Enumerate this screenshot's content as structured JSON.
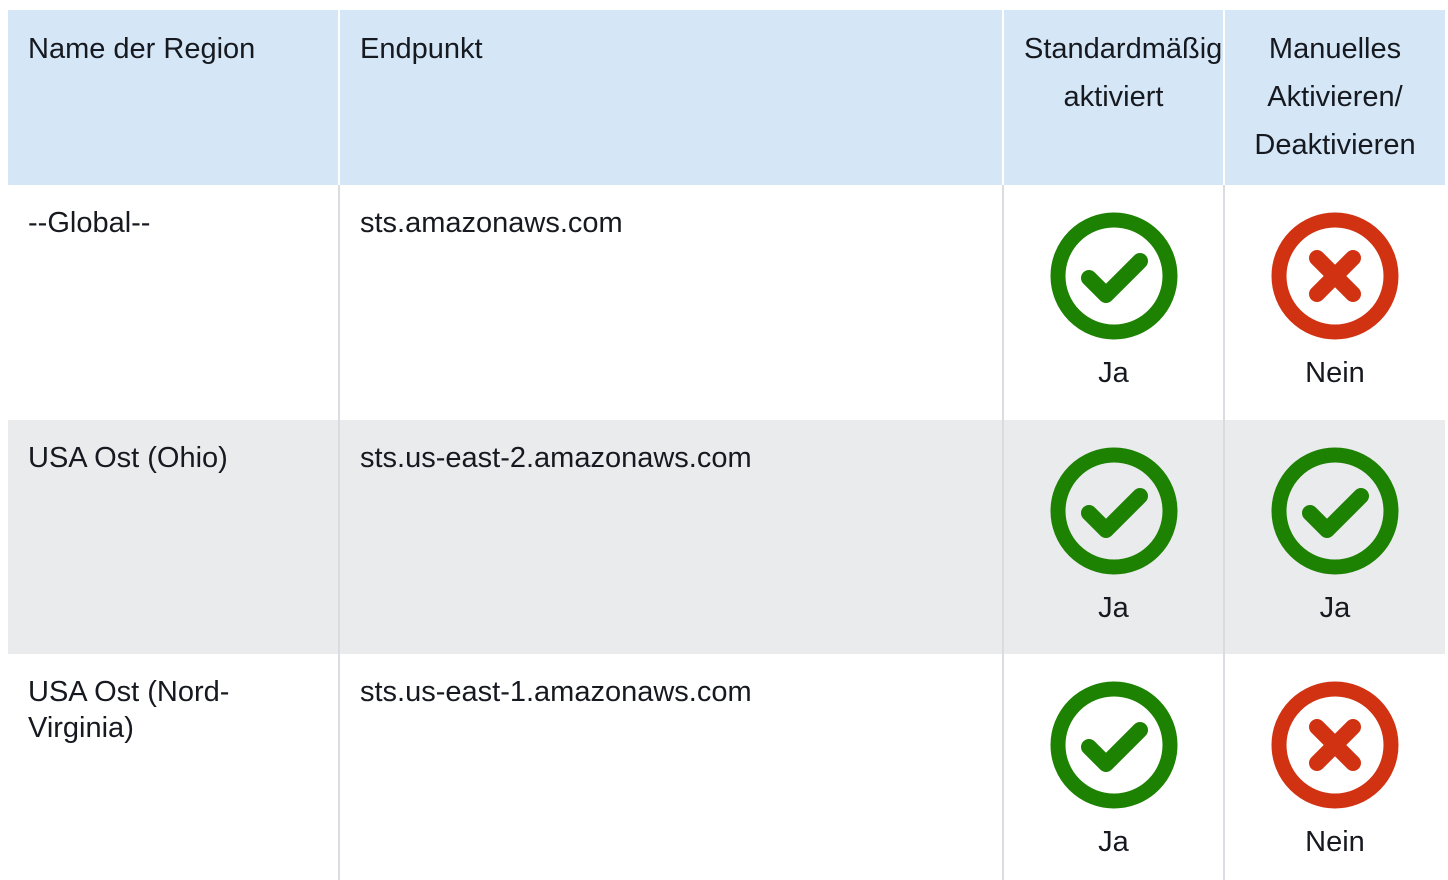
{
  "table": {
    "headers": {
      "region": "Name der Region",
      "endpoint": "Endpunkt",
      "default_enabled": "Standardmäßig aktiviert",
      "manual_toggle": "Manuelles Aktivieren/ Deaktivieren"
    },
    "rows": [
      {
        "region": "--Global--",
        "endpoint": "sts.amazonaws.com",
        "default_enabled": {
          "label": "Ja",
          "icon": "check-circle-icon",
          "color": "#1d8102"
        },
        "manual_toggle": {
          "label": "Nein",
          "icon": "x-circle-icon",
          "color": "#d13212"
        }
      },
      {
        "region": "USA Ost (Ohio)",
        "endpoint": "sts.us-east-2.amazonaws.com",
        "default_enabled": {
          "label": "Ja",
          "icon": "check-circle-icon",
          "color": "#1d8102"
        },
        "manual_toggle": {
          "label": "Ja",
          "icon": "check-circle-icon",
          "color": "#1d8102"
        }
      },
      {
        "region": "USA Ost (Nord-Virginia)",
        "endpoint": "sts.us-east-1.amazonaws.com",
        "default_enabled": {
          "label": "Ja",
          "icon": "check-circle-icon",
          "color": "#1d8102"
        },
        "manual_toggle": {
          "label": "Nein",
          "icon": "x-circle-icon",
          "color": "#d13212"
        }
      }
    ]
  }
}
